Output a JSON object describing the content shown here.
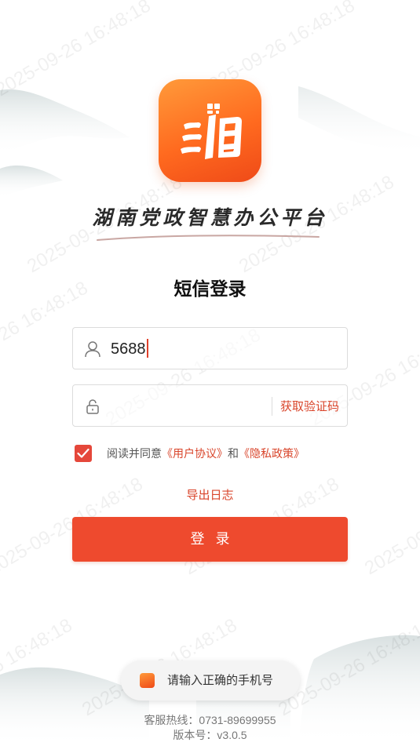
{
  "watermark": "2025-09-26 16:48:18",
  "app": {
    "title": "湖南党政智慧办公平台",
    "logo_icon": "xiang-logo-icon",
    "brand_color": "#f05a24"
  },
  "login": {
    "title": "短信登录",
    "phone_value": "5688",
    "code_placeholder": "",
    "get_code_label": "获取验证码",
    "agree_prefix": "阅读并同意",
    "user_agreement": "《用户协议》",
    "and": "和",
    "privacy_policy": "《隐私政策》",
    "agreed": true,
    "export_log_label": "导出日志",
    "submit_label": "登录"
  },
  "toast": {
    "message": "请输入正确的手机号"
  },
  "footer": {
    "hotline": "客服热线：0731-89699955",
    "version": "版本号：v3.0.5"
  },
  "colors": {
    "accent": "#ee4a2e",
    "link": "#d9452b",
    "checkbox": "#e5473a"
  }
}
